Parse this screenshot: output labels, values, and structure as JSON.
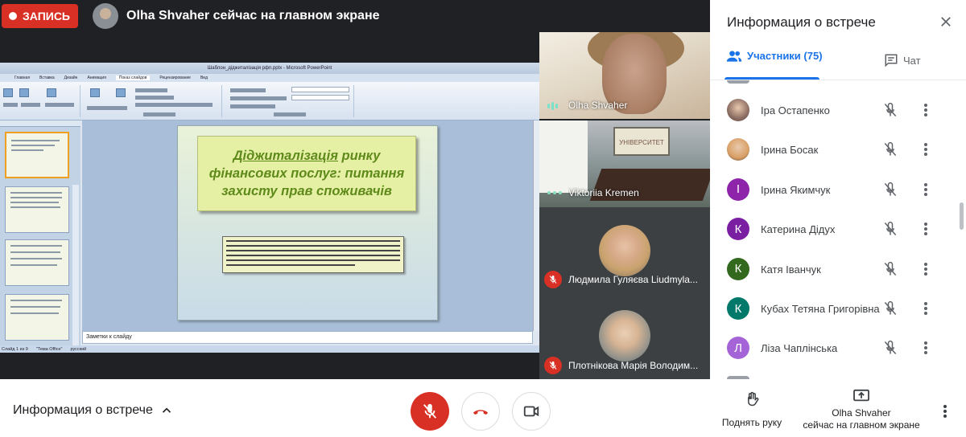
{
  "topbar": {
    "record_label": "ЗАПИСЬ",
    "presenter_text": "Olha Shvaher сейчас на главном экране"
  },
  "presentation": {
    "window_title": "Шаблон_діджиталізація рфп.pptx - Microsoft PowerPoint",
    "ribbon_tabs": [
      "Главная",
      "Вставка",
      "Дизайн",
      "Анимация",
      "Показ слайдов",
      "Рецензирование",
      "Вид"
    ],
    "left_tabs": [
      "Слайды",
      "Структура"
    ],
    "slide_title_underlined": "Діджиталізація",
    "slide_title_rest": " ринку фінансових послуг: питання захисту прав споживачів",
    "notes_placeholder": "Заметки к слайду",
    "status": [
      "Слайд 1 из 9",
      "\"Тема Office\"",
      "русский"
    ]
  },
  "tiles": [
    {
      "name": "Olha Shvaher",
      "indicator": "speaking"
    },
    {
      "name": "Viktoriia Kremen",
      "indicator": "dots",
      "screen_text": "УНІВЕРСИТЕТ"
    },
    {
      "name": "Людмила Гуляєва Liudmyla...",
      "indicator": "muted"
    },
    {
      "name": "Плотнікова Марія Володим...",
      "indicator": "muted"
    }
  ],
  "panel": {
    "title": "Информация о встрече",
    "tab_people": "Участники (75)",
    "tab_chat": "Чат",
    "participants": [
      {
        "name": "Іра Остапенко",
        "initial": "",
        "color": "#8d6e63",
        "photo": true
      },
      {
        "name": "Ірина Босак",
        "initial": "",
        "color": "#d9a066",
        "photo": true
      },
      {
        "name": "Ірина Якимчук",
        "initial": "І",
        "color": "#8e24aa",
        "photo": false
      },
      {
        "name": "Катерина Дідух",
        "initial": "К",
        "color": "#7b1fa2",
        "photo": false
      },
      {
        "name": "Катя Іванчук",
        "initial": "К",
        "color": "#33691e",
        "photo": false
      },
      {
        "name": "Кубах Тетяна Григорівна",
        "initial": "К",
        "color": "#00796b",
        "photo": false
      },
      {
        "name": "Ліза Чаплінська",
        "initial": "Л",
        "color": "#a463d6",
        "photo": false
      }
    ]
  },
  "bottombar": {
    "meeting_info": "Информация о встрече",
    "raise_hand": "Поднять руку",
    "presenting_line1": "Olha Shvaher",
    "presenting_line2": "сейчас на главном экране"
  },
  "colors": {
    "accent": "#1a73e8",
    "record": "#d93025",
    "dark_bg": "#202124"
  },
  "icons": [
    "record-dot-icon",
    "close-icon",
    "people-icon",
    "chat-icon",
    "mic-off-icon",
    "more-vert-icon",
    "chevron-up-icon",
    "hangup-icon",
    "camera-icon",
    "raise-hand-icon",
    "present-icon"
  ]
}
